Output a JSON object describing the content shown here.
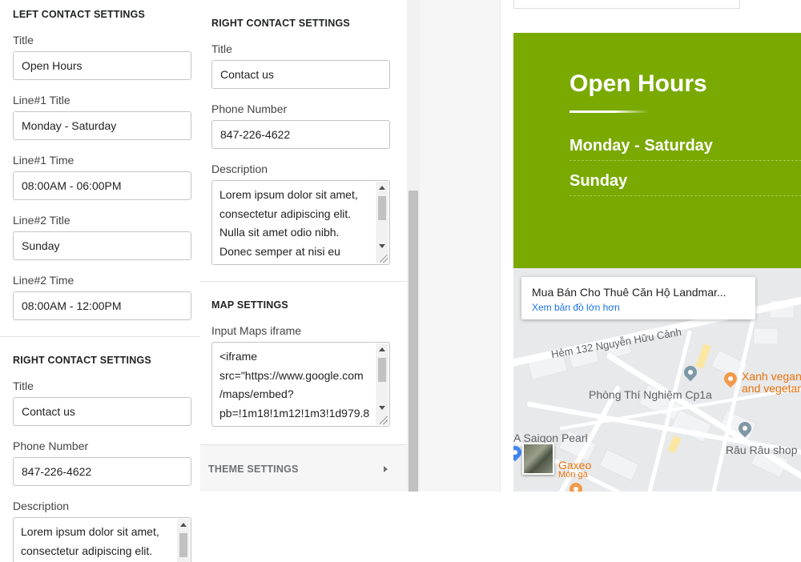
{
  "left_contact": {
    "heading": "LEFT CONTACT SETTINGS",
    "title_label": "Title",
    "title_value": "Open Hours",
    "line1_title_label": "Line#1 Title",
    "line1_title_value": "Monday - Saturday",
    "line1_time_label": "Line#1 Time",
    "line1_time_value": "08:00AM - 06:00PM",
    "line2_title_label": "Line#2 Title",
    "line2_title_value": "Sunday",
    "line2_time_label": "Line#2 Time",
    "line2_time_value": "08:00AM - 12:00PM"
  },
  "right_contact_left": {
    "heading": "RIGHT CONTACT SETTINGS",
    "title_label": "Title",
    "title_value": "Contact us",
    "phone_label": "Phone Number",
    "phone_value": "847-226-4622",
    "description_label": "Description",
    "description_value": "Lorem ipsum dolor sit amet,\nconsectetur adipiscing elit."
  },
  "right_contact_mid": {
    "heading": "RIGHT CONTACT SETTINGS",
    "title_label": "Title",
    "title_value": "Contact us",
    "phone_label": "Phone Number",
    "phone_value": "847-226-4622",
    "description_label": "Description",
    "description_value": "Lorem ipsum dolor sit amet,\nconsectetur adipiscing elit.\nNulla sit amet odio nibh.\nDonec semper at nisi eu"
  },
  "map_settings": {
    "heading": "MAP SETTINGS",
    "iframe_label": "Input Maps iframe",
    "iframe_value": "<iframe\nsrc=\"https://www.google.com\n/maps/embed?\npb=!1m18!1m12!1m3!1d979.8"
  },
  "theme_settings": {
    "label": "THEME SETTINGS",
    "icon": "chevron-right-icon"
  },
  "preview": {
    "hours_title": "Open Hours",
    "line1": "Monday - Saturday",
    "line2": "Sunday",
    "accent_color": "#7aa901",
    "map": {
      "place_name": "Mua Bán Cho Thuê Căn Hộ Landmar...",
      "larger_map_link": "Xem bản đồ lớn hơn",
      "street": "Hẻm 132 Nguyễn Hữu Cảnh",
      "poi_1": "Phòng Thí Nghiệm Cp1a",
      "poi_2_line1": "Xanh vegan",
      "poi_2_line2": "and vegetari",
      "poi_3": "Râu Râu shop",
      "poi_4": "A Saigon Pearl",
      "poi_5": "Gaxeo",
      "poi_5_sub": "Món gà",
      "link_color": "#1a73e8"
    }
  }
}
